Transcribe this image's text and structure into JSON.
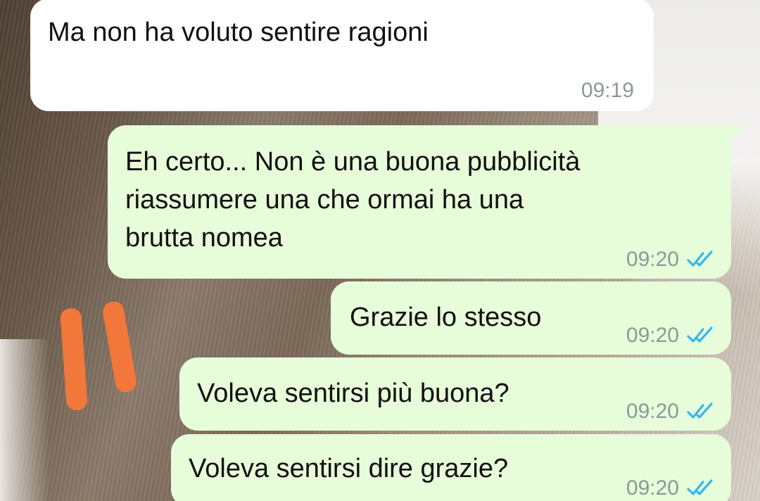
{
  "colors": {
    "incoming_bubble": "#ffffff",
    "outgoing_bubble": "#e7fcd9",
    "timestamp": "#8a9a96",
    "read_ticks": "#34b7f1",
    "annotation_marks": "#f2773a"
  },
  "messages": [
    {
      "direction": "incoming",
      "text": "Ma non ha voluto sentire ragioni",
      "time": "09:19"
    },
    {
      "direction": "outgoing",
      "text": "Eh certo... Non è una buona pubblicità\nriassumere una che ormai ha una\nbrutta nomea",
      "time": "09:20",
      "status_icon": "double-check-read-icon"
    },
    {
      "direction": "outgoing",
      "text": "Grazie lo stesso",
      "time": "09:20",
      "status_icon": "double-check-read-icon"
    },
    {
      "direction": "outgoing",
      "text": "Voleva sentirsi più buona?",
      "time": "09:20",
      "status_icon": "double-check-read-icon"
    },
    {
      "direction": "outgoing",
      "text": "Voleva sentirsi dire grazie?",
      "time": "09:20",
      "status_icon": "double-check-read-icon"
    }
  ]
}
